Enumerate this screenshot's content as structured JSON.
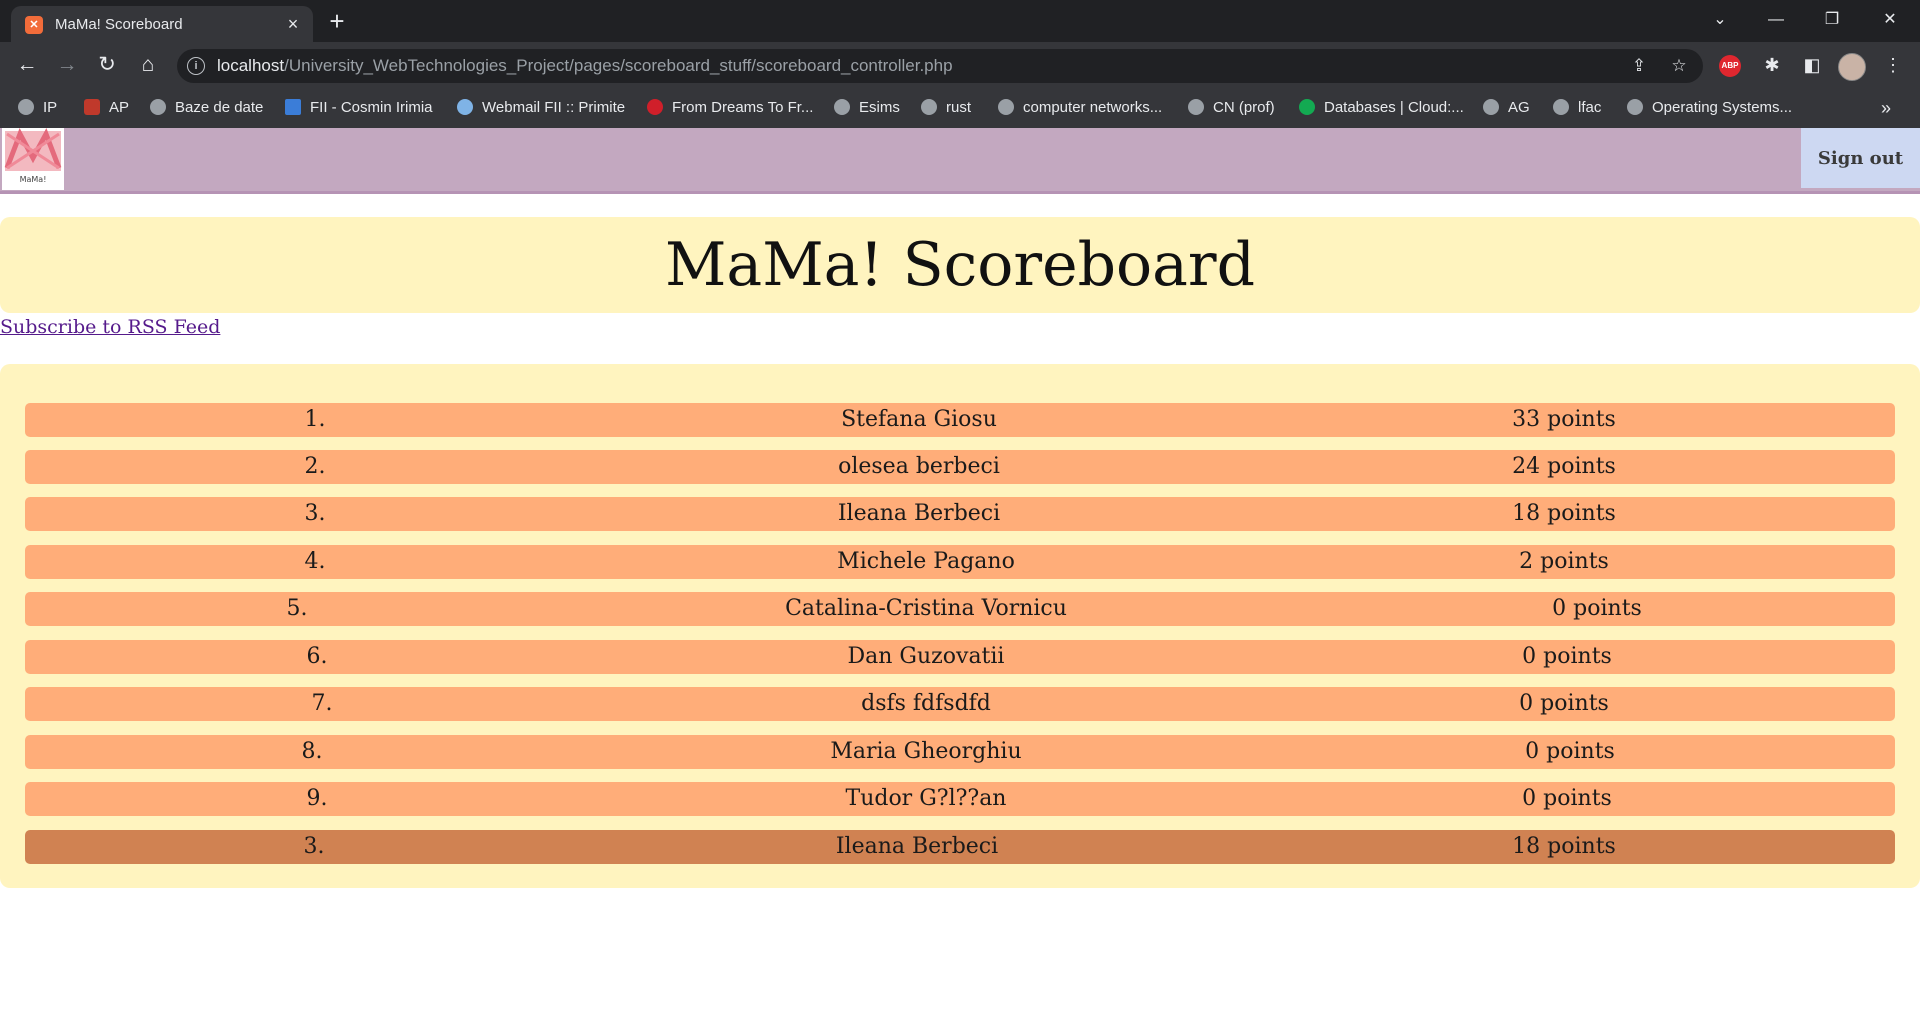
{
  "browser": {
    "tab_title": "MaMa! Scoreboard",
    "url_host": "localhost",
    "url_path": "/University_WebTechnologies_Project/pages/scoreboard_stuff/scoreboard_controller.php",
    "bookmarks": [
      {
        "label": "IP",
        "icon": "globe-icon"
      },
      {
        "label": "AP",
        "icon": "bookmark-icon"
      },
      {
        "label": "Baze de date",
        "icon": "globe-icon"
      },
      {
        "label": "FII - Cosmin Irimia",
        "icon": "site-icon"
      },
      {
        "label": "Webmail FII :: Primite",
        "icon": "mail-icon"
      },
      {
        "label": "From Dreams To Fr...",
        "icon": "site-icon"
      },
      {
        "label": "Esims",
        "icon": "globe-icon"
      },
      {
        "label": "rust",
        "icon": "globe-icon"
      },
      {
        "label": "computer networks...",
        "icon": "globe-icon"
      },
      {
        "label": "CN (prof)",
        "icon": "globe-icon"
      },
      {
        "label": "Databases | Cloud:...",
        "icon": "leaf-icon"
      },
      {
        "label": "AG",
        "icon": "globe-icon"
      },
      {
        "label": "lfac",
        "icon": "globe-icon"
      },
      {
        "label": "Operating Systems...",
        "icon": "globe-icon"
      }
    ],
    "extension_badge": "ABP"
  },
  "header": {
    "logo_text": "MaMa!",
    "signout_label": "Sign out"
  },
  "main": {
    "title": "MaMa! Scoreboard",
    "rss_link": "Subscribe to RSS Feed",
    "rows": [
      {
        "rank": "1.",
        "name": "Stefana Giosu",
        "points": "33 points"
      },
      {
        "rank": "2.",
        "name": "olesea berbeci",
        "points": "24 points"
      },
      {
        "rank": "3.",
        "name": "Ileana Berbeci",
        "points": "18 points"
      },
      {
        "rank": "4.",
        "name": "Michele Pagano",
        "points": "2 points"
      },
      {
        "rank": "5.",
        "name": "Catalina-Cristina Vornicu",
        "points": "0 points"
      },
      {
        "rank": "6.",
        "name": "Dan Guzovatii",
        "points": "0 points"
      },
      {
        "rank": "7.",
        "name": "dsfs fdfsdfd",
        "points": "0 points"
      },
      {
        "rank": "8.",
        "name": "Maria Gheorghiu",
        "points": "0 points"
      },
      {
        "rank": "9.",
        "name": "Tudor G?l??an",
        "points": "0 points"
      }
    ],
    "current_user": {
      "rank": "3.",
      "name": "Ileana Berbeci",
      "points": "18 points"
    }
  },
  "colors": {
    "header_bg": "#c3a8c0",
    "panel_bg": "#fff4bf",
    "row_bg": "#ffad79",
    "current_user_row_bg": "#d08252",
    "signout_bg": "#cdd8f2"
  }
}
